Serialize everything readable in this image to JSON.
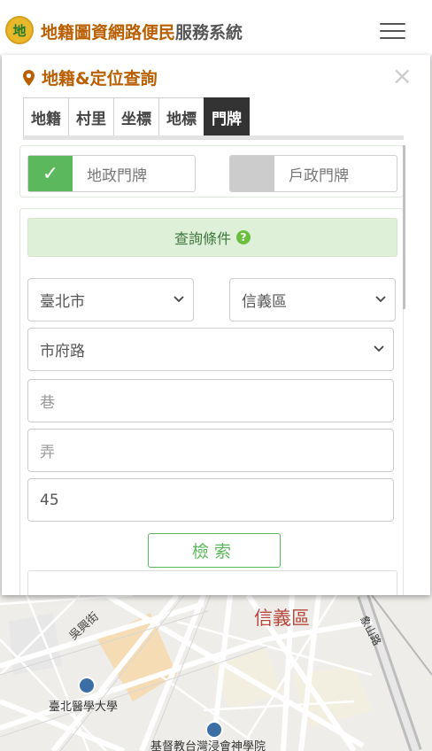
{
  "header": {
    "logo_mark": "地",
    "title_part1": "地籍圖資網路便民",
    "title_part2": "服務系統"
  },
  "panel": {
    "title": "地籍&定位查詢",
    "close": "×",
    "tabs": [
      {
        "label": "地籍",
        "active": false
      },
      {
        "label": "村里",
        "active": false
      },
      {
        "label": "坐標",
        "active": false
      },
      {
        "label": "地標",
        "active": false
      },
      {
        "label": "門牌",
        "active": true
      }
    ],
    "toggles": [
      {
        "label": "地政門牌",
        "checked": true,
        "mark": "✓"
      },
      {
        "label": "戶政門牌",
        "checked": false,
        "mark": ""
      }
    ],
    "query_header": "查詢條件",
    "help": "?",
    "city": "臺北市",
    "district": "信義區",
    "road": "市府路",
    "lane_placeholder": "巷",
    "alley_placeholder": "弄",
    "number": "45",
    "search_button": "檢索"
  },
  "map": {
    "labels": {
      "district": "信義區",
      "street": "吳興街",
      "university": "臺北醫學大學",
      "seminary": "基督教台灣浸會神學院",
      "road": "象山路"
    }
  },
  "colors": {
    "brand_orange": "#b95f00",
    "success_green": "#5cb85c",
    "query_bg": "#dff0d8",
    "tab_active": "#333333"
  }
}
